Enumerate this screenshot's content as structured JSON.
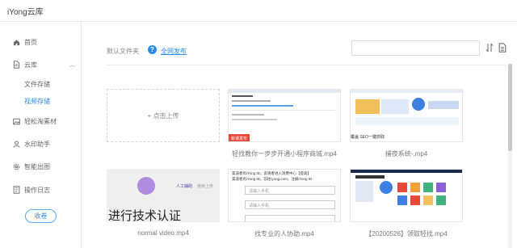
{
  "app": {
    "title": "iYong云库"
  },
  "sidebar": {
    "items": [
      {
        "label": "首页",
        "icon": "home-icon"
      },
      {
        "label": "云库",
        "icon": "file-icon",
        "expanded": true,
        "children": [
          {
            "label": "文件存储",
            "active": false
          },
          {
            "label": "视频存储",
            "active": true
          }
        ]
      },
      {
        "label": "轻松淘素材",
        "icon": "image-icon"
      },
      {
        "label": "水印助手",
        "icon": "user-icon"
      },
      {
        "label": "智能出图",
        "icon": "gear-icon"
      },
      {
        "label": "操作日志",
        "icon": "log-icon"
      }
    ],
    "collapse_label": "收卷"
  },
  "toolbar": {
    "default_folder": "默认文件夹",
    "publish_link": "全网发布",
    "search_placeholder": ""
  },
  "grid": {
    "upload_label": "+ 点击上传",
    "files": [
      {
        "name": "轻找教你一步步开通小程序商城.mp4"
      },
      {
        "name": "捕夜系统-.mp4"
      },
      {
        "name": "normal video.mp4"
      },
      {
        "name": "找专业的人协助.mp4"
      },
      {
        "name": "【20200526】领取轻找.mp4"
      }
    ]
  },
  "thumbs": {
    "t1_badge": "新课发布",
    "t2_label": "覆盖 SEO一键抓取",
    "t3_btn": "人工辅助",
    "t3_btn2": "继续上传",
    "t3_overlay": "进行技术认证",
    "t4_line1": "渠道者有iYong ID，说请者进入消费中心【提高】",
    "t4_line2": "渠道者有iYong ID，前往iyong.com，注册iYong ID",
    "t4_field": "请输入手机"
  },
  "colors": {
    "accent": "#2b8ce8",
    "border": "#e8e8e8"
  }
}
